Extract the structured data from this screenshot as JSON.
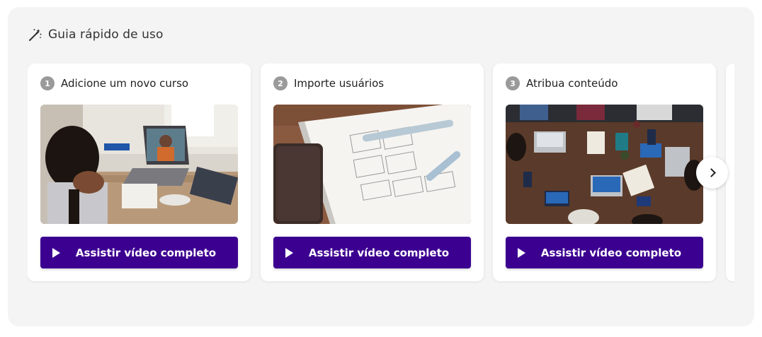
{
  "panel": {
    "title": "Guia rápido de uso",
    "icon": "magic-wand-icon"
  },
  "cards": [
    {
      "step": "1",
      "title": "Adicione um novo curso",
      "image": "girl-video-call-laptop-photo",
      "button_label": "Assistir vídeo completo",
      "button_icon": "play-icon"
    },
    {
      "step": "2",
      "title": "Importe usuários",
      "image": "wireframe-sketch-notebook-photo",
      "button_label": "Assistir vídeo completo",
      "button_icon": "play-icon"
    },
    {
      "step": "3",
      "title": "Atribua conteúdo",
      "image": "team-meeting-table-photo",
      "button_label": "Assistir vídeo completo",
      "button_icon": "play-icon"
    }
  ],
  "carousel": {
    "next_icon": "chevron-right-icon"
  },
  "colors": {
    "panel_bg": "#f4f4f4",
    "button_bg": "#3c0091",
    "step_badge": "#9a9a9a"
  }
}
